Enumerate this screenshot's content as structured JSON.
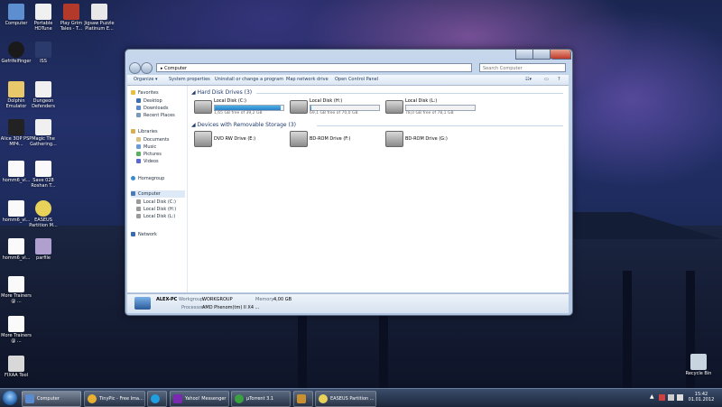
{
  "desktop": {
    "icons": [
      {
        "label": "Computer"
      },
      {
        "label": "Portable HDTune"
      },
      {
        "label": "Play Grim Tales - T..."
      },
      {
        "label": "Jigsaw Puzzle Platinum E..."
      },
      {
        "label": "Gefrifelfinger"
      },
      {
        "label": "ISS"
      },
      {
        "label": "Dolphin Emulator"
      },
      {
        "label": "Dungeon Defenders"
      },
      {
        "label": "Alice 3OP PSP MP4..."
      },
      {
        "label": "Magic The Gathering..."
      },
      {
        "label": "homm6_vi..."
      },
      {
        "label": "Save 028 Roshan T..."
      },
      {
        "label": "homm6_vi..."
      },
      {
        "label": "EASEUS Partition M..."
      },
      {
        "label": "homm6_vi..."
      },
      {
        "label": "parfile"
      },
      {
        "label": "More Trainers @ ..."
      },
      {
        "label": "More Trainers @ ..."
      },
      {
        "label": "FIXAA Tool"
      },
      {
        "label": "Recycle Bin"
      }
    ]
  },
  "window": {
    "address": "Computer",
    "search_placeholder": "Search Computer",
    "toolbar": [
      "Organize ▾",
      "System properties",
      "Uninstall or change a program",
      "Map network drive",
      "Open Control Panel"
    ],
    "nav": {
      "favorites": "Favorites",
      "desktop": "Desktop",
      "downloads": "Downloads",
      "recent": "Recent Places",
      "libraries": "Libraries",
      "documents": "Documents",
      "music": "Music",
      "pictures": "Pictures",
      "videos": "Videos",
      "homegroup": "Homegroup",
      "computer": "Computer",
      "c": "Local Disk (C:)",
      "h": "Local Disk (H:)",
      "l": "Local Disk (L:)",
      "network": "Network"
    },
    "hdd_header": "Hard Disk Drives (3)",
    "removable_header": "Devices with Removable Storage (3)",
    "drives": [
      {
        "name": "Local Disk (C:)",
        "free": "1,65 GB free of 39,2 GB",
        "used_fraction": 0.96
      },
      {
        "name": "Local Disk (H:)",
        "free": "69,1 GB free of 70,0 GB",
        "used_fraction": 0.01
      },
      {
        "name": "Local Disk (L:)",
        "free": "78,0 GB free of 78,1 GB",
        "used_fraction": 0.0
      }
    ],
    "removable": [
      {
        "name": "DVD RW Drive (E:)"
      },
      {
        "name": "BD-ROM Drive (F:)"
      },
      {
        "name": "BD-ROM Drive (G:)"
      }
    ],
    "status": {
      "pc": "ALEX-PC",
      "workgroup_label": "Workgroup:",
      "workgroup": "WORKGROUP",
      "memory_label": "Memory:",
      "memory": "4,00 GB",
      "processor_label": "Processor:",
      "processor": "AMD Phenom(tm) II X4 ..."
    }
  },
  "taskbar": {
    "tasks": [
      {
        "label": "Computer"
      },
      {
        "label": "TinyPic - Free Ima..."
      },
      {
        "label": ""
      },
      {
        "label": "Yahoo! Messenger"
      },
      {
        "label": "µTorrent 3.1"
      },
      {
        "label": ""
      },
      {
        "label": "EASEUS Partition ..."
      }
    ],
    "time": "15:42",
    "date": "01.01.2012"
  }
}
